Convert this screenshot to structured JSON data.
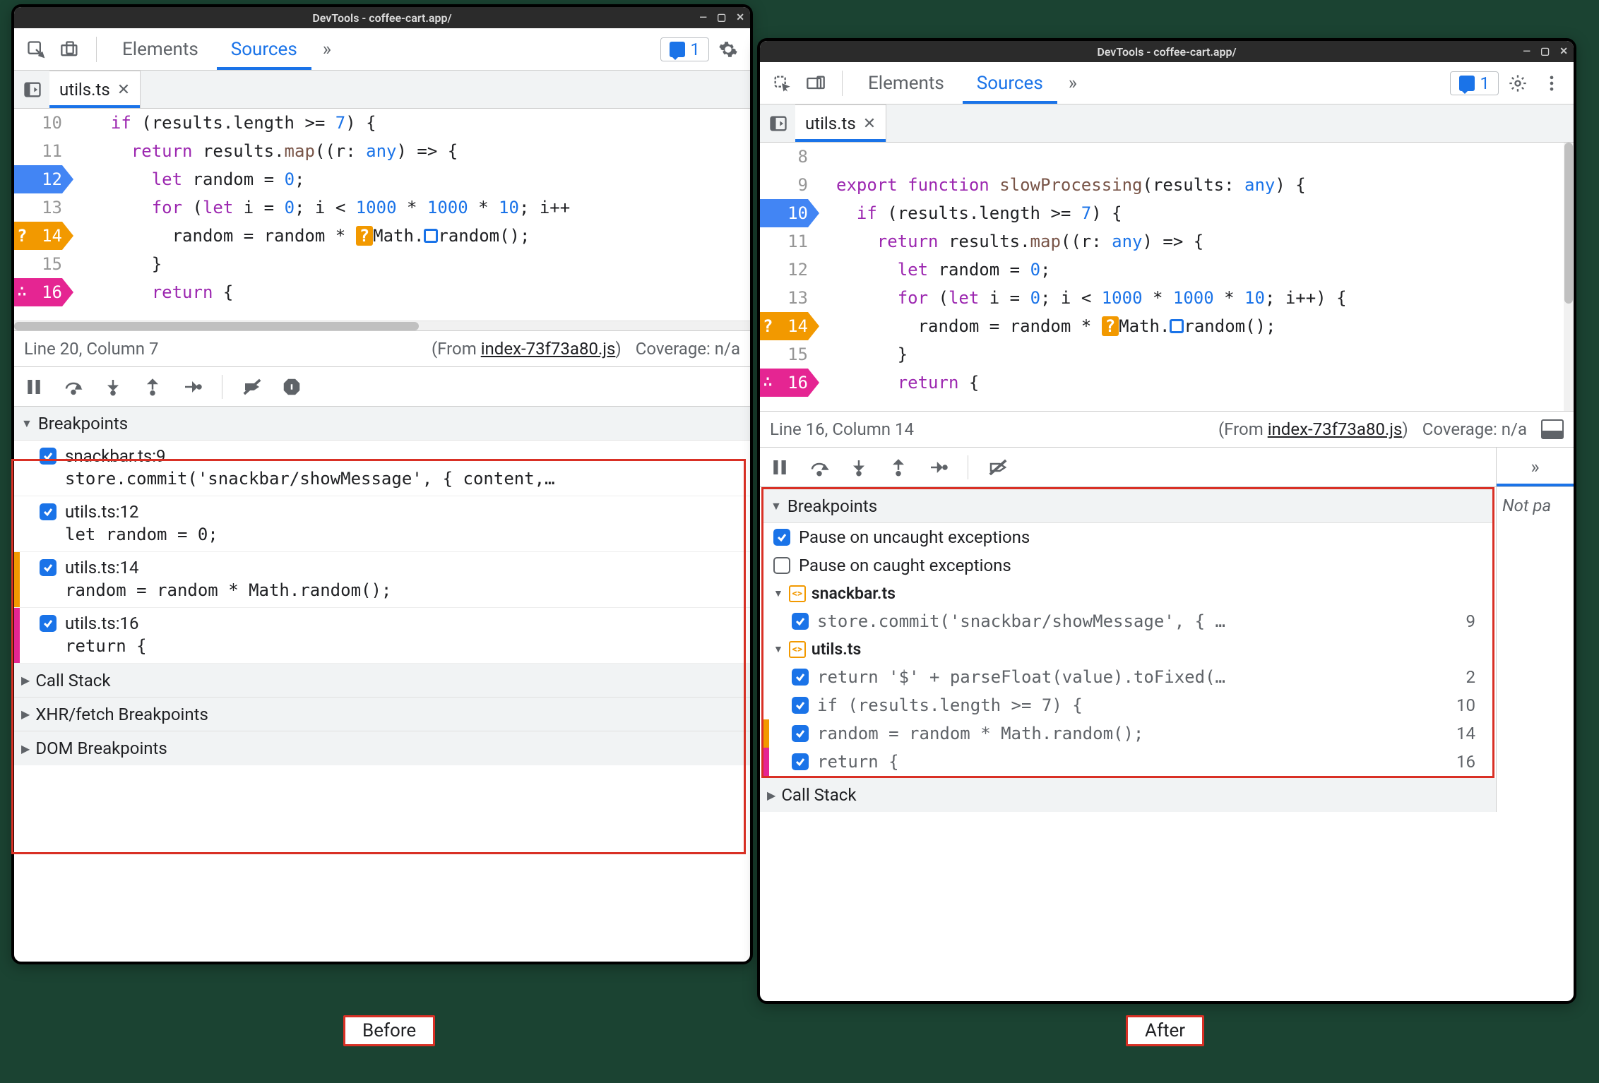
{
  "labels": {
    "before": "Before",
    "after": "After"
  },
  "before": {
    "title": "DevTools - coffee-cart.app/",
    "tabs": {
      "elements": "Elements",
      "sources": "Sources"
    },
    "issues_count": "1",
    "file": "utils.ts",
    "code": {
      "lines": [
        {
          "num": "10",
          "bp": "",
          "html": "  <span class='tok-kw'>if</span> (results.length &gt;= <span class='tok-num'>7</span>) {"
        },
        {
          "num": "11",
          "bp": "",
          "html": "    <span class='tok-kw'>return</span> results.<span class='tok-fn'>map</span>((r: <span class='tok-type'>any</span>) =&gt; {"
        },
        {
          "num": "12",
          "bp": "blue",
          "html": "      <span class='tok-kw'>let</span> random = <span class='tok-num'>0</span>;"
        },
        {
          "num": "13",
          "bp": "",
          "html": "      <span class='tok-kw'>for</span> (<span class='tok-kw'>let</span> i = <span class='tok-num'>0</span>; i &lt; <span class='tok-num'>1000</span> * <span class='tok-num'>1000</span> * <span class='tok-num'>10</span>; i++"
        },
        {
          "num": "14",
          "bp": "orange",
          "html": "        random = random * <span class='inline-orange'>?</span>Math.<span class='inline-blue'></span>random();"
        },
        {
          "num": "15",
          "bp": "",
          "html": "      }"
        },
        {
          "num": "16",
          "bp": "pink",
          "html": "      <span class='tok-kw'>return</span> {"
        }
      ]
    },
    "status": {
      "pos": "Line 20, Column 7",
      "from_prefix": "(From ",
      "from_file": "index-73f73a80.js",
      "from_suffix": ")",
      "coverage": "Coverage: n/a"
    },
    "breakpoints_header": "Breakpoints",
    "breakpoints": [
      {
        "file": "snackbar.ts:9",
        "code": "store.commit('snackbar/showMessage', { content,…",
        "stripe": ""
      },
      {
        "file": "utils.ts:12",
        "code": "let random = 0;",
        "stripe": ""
      },
      {
        "file": "utils.ts:14",
        "code": "random = random * Math.random();",
        "stripe": "#f29900"
      },
      {
        "file": "utils.ts:16",
        "code": "return {",
        "stripe": "#e52592"
      }
    ],
    "panels": {
      "callstack": "Call Stack",
      "xhr": "XHR/fetch Breakpoints",
      "dom": "DOM Breakpoints"
    }
  },
  "after": {
    "title": "DevTools - coffee-cart.app/",
    "tabs": {
      "elements": "Elements",
      "sources": "Sources"
    },
    "issues_count": "1",
    "file": "utils.ts",
    "code": {
      "lines": [
        {
          "num": "8",
          "bp": "",
          "html": ""
        },
        {
          "num": "9",
          "bp": "",
          "html": "<span class='tok-kw'>export</span> <span class='tok-kw'>function</span> <span class='tok-fn'>slowProcessing</span>(results: <span class='tok-type'>any</span>) {"
        },
        {
          "num": "10",
          "bp": "blue",
          "html": "  <span class='tok-kw'>if</span> (results.length &gt;= <span class='tok-num'>7</span>) {"
        },
        {
          "num": "11",
          "bp": "",
          "html": "    <span class='tok-kw'>return</span> results.<span class='tok-fn'>map</span>((r: <span class='tok-type'>any</span>) =&gt; {"
        },
        {
          "num": "12",
          "bp": "",
          "html": "      <span class='tok-kw'>let</span> random = <span class='tok-num'>0</span>;"
        },
        {
          "num": "13",
          "bp": "",
          "html": "      <span class='tok-kw'>for</span> (<span class='tok-kw'>let</span> i = <span class='tok-num'>0</span>; i &lt; <span class='tok-num'>1000</span> * <span class='tok-num'>1000</span> * <span class='tok-num'>10</span>; i++) {"
        },
        {
          "num": "14",
          "bp": "orange",
          "html": "        random = random * <span class='inline-orange'>?</span>Math.<span class='inline-blue'></span>random();"
        },
        {
          "num": "15",
          "bp": "",
          "html": "      }"
        },
        {
          "num": "16",
          "bp": "pink",
          "html": "      <span class='tok-kw'>return</span> {"
        }
      ]
    },
    "status": {
      "pos": "Line 16, Column 14",
      "from_prefix": "(From ",
      "from_file": "index-73f73a80.js",
      "from_suffix": ")",
      "coverage": "Coverage: n/a"
    },
    "breakpoints_header": "Breakpoints",
    "options": {
      "uncaught": "Pause on uncaught exceptions",
      "caught": "Pause on caught exceptions"
    },
    "bp_files": [
      {
        "name": "snackbar.ts",
        "lines": [
          {
            "code": "store.commit('snackbar/showMessage', { …",
            "num": "9",
            "stripe": ""
          }
        ]
      },
      {
        "name": "utils.ts",
        "lines": [
          {
            "code": "return '$' + parseFloat(value).toFixed(…",
            "num": "2",
            "stripe": ""
          },
          {
            "code": "if (results.length >= 7) {",
            "num": "10",
            "stripe": ""
          },
          {
            "code": "random = random * Math.random();",
            "num": "14",
            "stripe": "#f29900"
          },
          {
            "code": "return {",
            "num": "16",
            "stripe": "#e52592"
          }
        ]
      }
    ],
    "panels": {
      "callstack": "Call Stack"
    },
    "right_pane": {
      "notpaused": "Not pa"
    }
  }
}
